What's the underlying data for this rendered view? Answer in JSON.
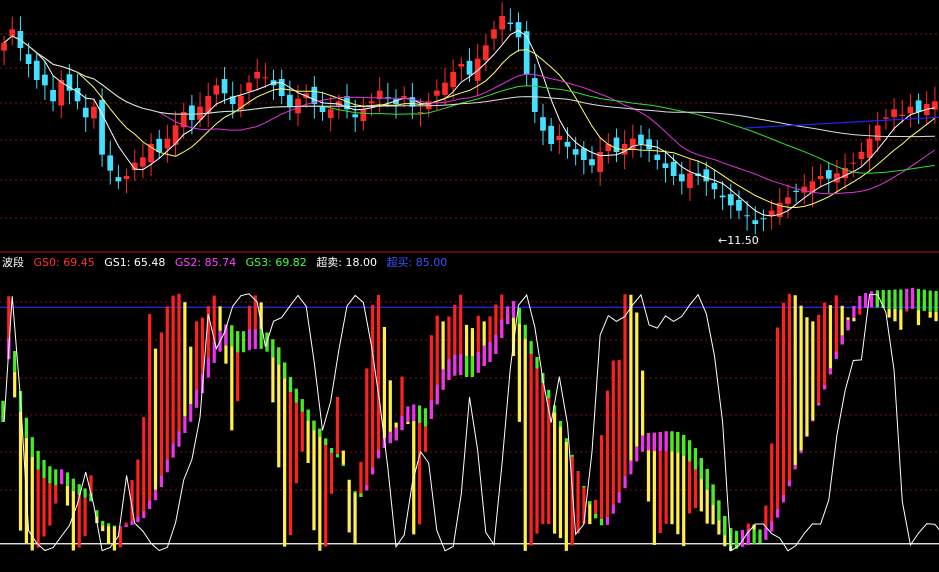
{
  "chart_data": [
    {
      "type": "candlestick",
      "title": "",
      "min_price_label": "←11.50",
      "colors": {
        "up": "#ff2a2a",
        "down": "#44e0ff",
        "ma5": "#ffffff",
        "ma10": "#ffff66",
        "ma20": "#dd33dd",
        "ma60": "#33dd33",
        "ma120": "#dddddd",
        "blue_line": "#2222ff"
      },
      "ohlc_close": [
        18.4,
        18.9,
        18.2,
        17.6,
        17.0,
        16.8,
        16.2,
        17.0,
        16.6,
        16.2,
        15.6,
        16.0,
        14.2,
        13.6,
        13.2,
        13.4,
        13.9,
        14.1,
        14.6,
        14.3,
        14.8,
        15.3,
        15.8,
        15.5,
        16.0,
        16.4,
        16.8,
        16.5,
        16.1,
        16.4,
        16.9,
        17.3,
        17.1,
        16.8,
        16.4,
        16.0,
        16.3,
        16.5,
        16.1,
        15.8,
        15.9,
        16.2,
        15.9,
        15.6,
        15.9,
        16.2,
        16.6,
        16.3,
        16.1,
        16.4,
        16.0,
        15.8,
        16.2,
        16.6,
        16.9,
        17.3,
        17.6,
        17.2,
        17.8,
        18.3,
        18.9,
        19.4,
        19.1,
        18.6,
        17.2,
        15.8,
        15.1,
        14.6,
        14.9,
        14.5,
        14.2,
        14.0,
        13.8,
        14.3,
        14.6,
        14.3,
        14.6,
        14.8,
        14.6,
        14.4,
        14.0,
        13.7,
        13.4,
        13.2,
        13.5,
        13.4,
        13.2,
        12.9,
        12.6,
        12.3,
        12.1,
        11.9,
        11.6,
        11.8,
        12.1,
        12.4,
        12.6,
        12.8,
        13.0,
        13.2,
        13.4,
        13.3,
        13.5,
        13.7,
        13.9,
        14.3,
        14.8,
        15.3,
        15.6,
        15.9,
        15.7,
        16.0,
        15.8,
        16.1,
        16.2
      ],
      "series": [
        {
          "name": "GS0",
          "label": "GS0:",
          "value": "69.45",
          "color": "#ff3030"
        },
        {
          "name": "GS1",
          "label": "GS1:",
          "value": "65.48",
          "color": "#ffffff"
        },
        {
          "name": "GS2",
          "label": "GS2:",
          "value": "85.74",
          "color": "#ff44ff"
        },
        {
          "name": "GS3",
          "label": "GS3:",
          "value": "69.82",
          "color": "#44ff44"
        }
      ],
      "oversold": {
        "label": "超卖:",
        "value": "18.00"
      },
      "overbought": {
        "label": "超买:",
        "value": "85.00"
      },
      "indicator_name": "波段",
      "ylim": [
        10,
        95
      ]
    }
  ],
  "legend": {
    "name": "波段",
    "gs0": "GS0: 69.45",
    "gs1": "GS1: 65.48",
    "gs2": "GS2: 85.74",
    "gs3": "GS3: 69.82",
    "oversell": "超卖: 18.00",
    "overbuy": "超买: 85.00"
  }
}
